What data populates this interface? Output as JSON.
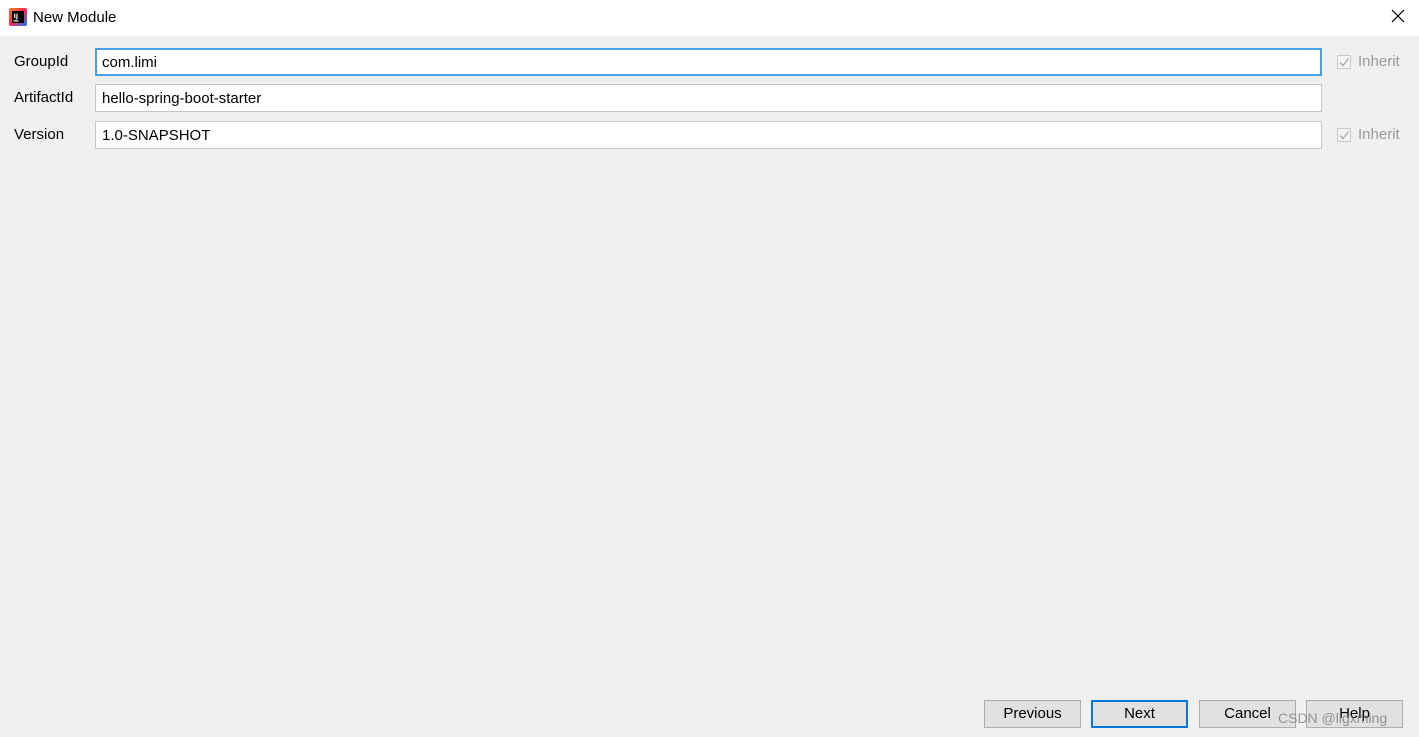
{
  "window": {
    "title": "New Module",
    "app_icon": "intellij-idea-icon",
    "close_icon": "close-icon"
  },
  "form": {
    "group_id": {
      "label": "GroupId",
      "value": "com.limi",
      "inherit_label": "Inherit",
      "inherit_checked": true
    },
    "artifact_id": {
      "label": "ArtifactId",
      "value": "hello-spring-boot-starter"
    },
    "version": {
      "label": "Version",
      "value": "1.0-SNAPSHOT",
      "inherit_label": "Inherit",
      "inherit_checked": true
    }
  },
  "buttons": {
    "previous": "Previous",
    "next": "Next",
    "cancel": "Cancel",
    "help": "Help"
  },
  "watermark": "CSDN @ligxming",
  "colors": {
    "background": "#f0f0f0",
    "focus_border": "#4b9ee8",
    "default_button_border": "#0078d7",
    "disabled_text": "#9a9a9a"
  }
}
